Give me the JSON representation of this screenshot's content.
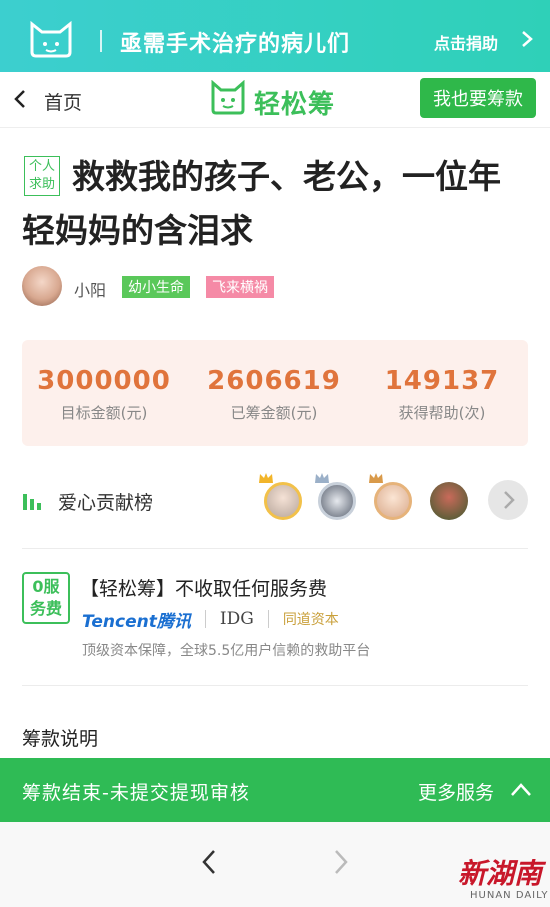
{
  "banner": {
    "title": "亟需手术治疗的病儿们",
    "donate_label": "点击捐助",
    "accent": "#3ccfcf"
  },
  "nav": {
    "home_label": "首页",
    "brand": "轻松筹",
    "raise_button": "我也要筹款",
    "accent": "#2fb84a"
  },
  "campaign": {
    "tag": "个人求助",
    "tag_line1": "个人",
    "tag_line2": "求助",
    "title": "救救我的孩子、老公，一位年轻妈妈的含泪求",
    "author": "小阳",
    "badges": [
      "幼小生命",
      "飞来横祸"
    ]
  },
  "stats": [
    {
      "value": "3000000",
      "label": "目标金额(元)"
    },
    {
      "value": "2606619",
      "label": "已筹金额(元)"
    },
    {
      "value": "149137",
      "label": "获得帮助(次)"
    }
  ],
  "board": {
    "label": "爱心贡献榜"
  },
  "service": {
    "fee_tag_line1": "0服",
    "fee_tag_line2": "务费",
    "title": "【轻松筹】不收取任何服务费",
    "partner_tencent": "Tencent腾讯",
    "partner_idg": "IDG",
    "partner_yd": "同道资本",
    "description": "顶级资本保障，全球5.5亿用户信赖的救助平台"
  },
  "explain_label": "筹款说明",
  "status_bar": {
    "status_text": "筹款结束-未提交提现审核",
    "more_services": "更多服务"
  },
  "watermark": {
    "cn": "新湖南",
    "en": "HUNAN DAILY"
  },
  "icons": [
    "cat-logo-icon",
    "chevron-right-icon",
    "back-icon",
    "bar-chart-icon",
    "crown-icon",
    "chevron-up-icon",
    "browser-back-icon",
    "browser-forward-icon"
  ]
}
